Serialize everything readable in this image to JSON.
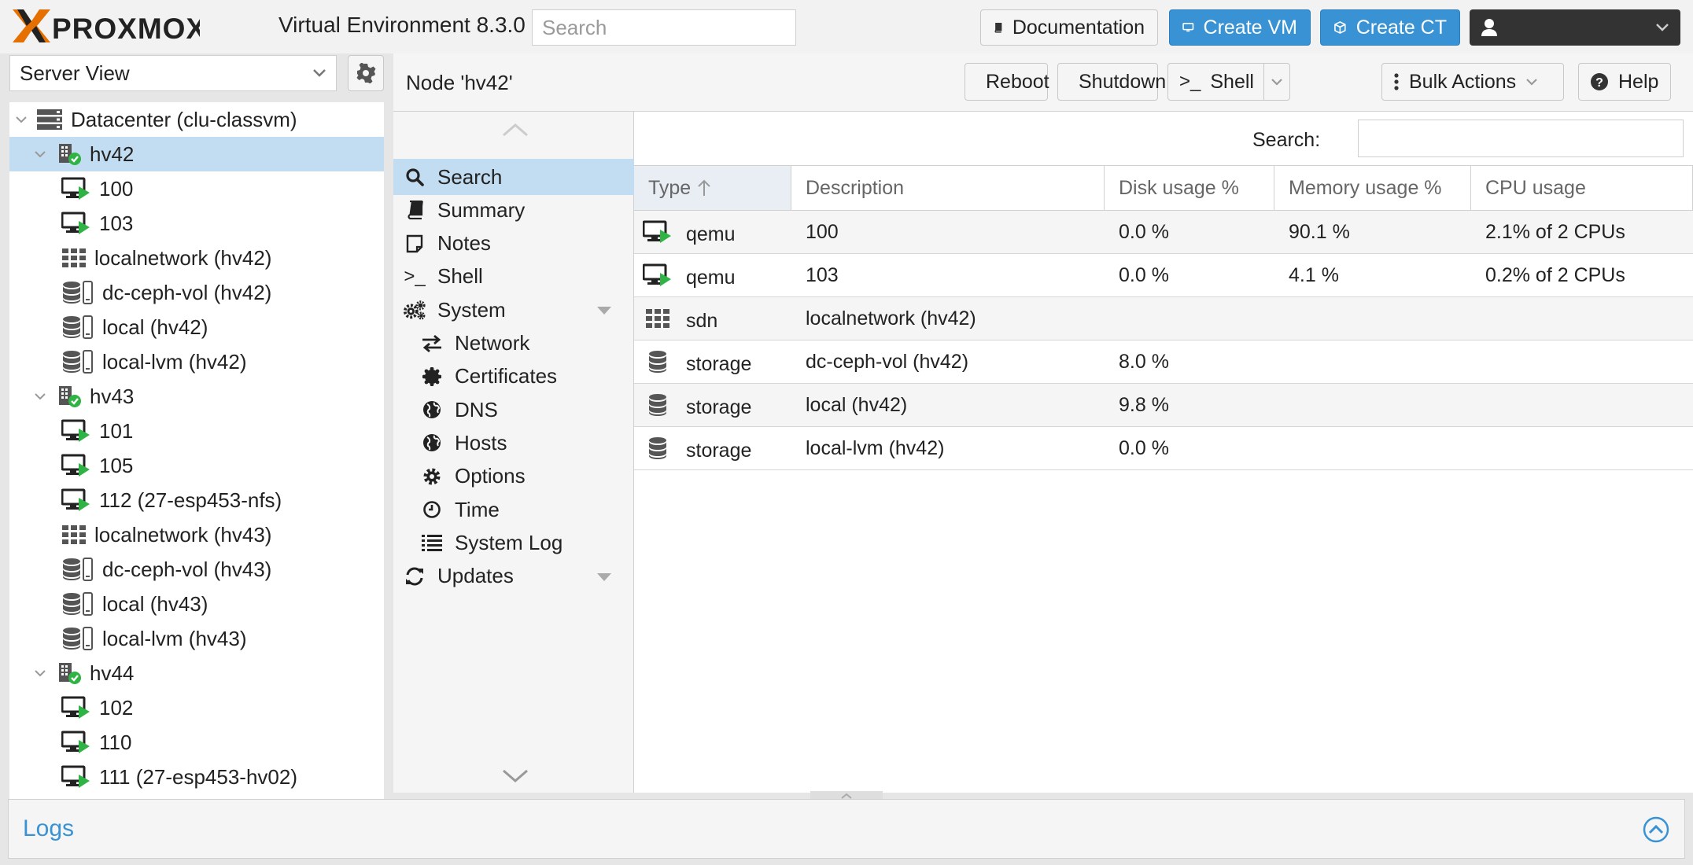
{
  "header": {
    "logo_text": "PROXMOX",
    "product": "Virtual Environment 8.3.0",
    "search_placeholder": "Search",
    "documentation": "Documentation",
    "create_vm": "Create VM",
    "create_ct": "Create CT"
  },
  "left": {
    "view": "Server View",
    "tree": [
      {
        "label": "Datacenter (clu-classvm)",
        "icon": "datacenter-icon",
        "level": 0,
        "expanded": true
      },
      {
        "label": "hv42",
        "icon": "node-online-icon",
        "level": 1,
        "expanded": true,
        "selected": true
      },
      {
        "label": "100",
        "icon": "vm-running-icon",
        "level": 2
      },
      {
        "label": "103",
        "icon": "vm-running-icon",
        "level": 2
      },
      {
        "label": "localnetwork (hv42)",
        "icon": "sdn-icon",
        "level": 2
      },
      {
        "label": "dc-ceph-vol (hv42)",
        "icon": "storage-icon",
        "level": 2
      },
      {
        "label": "local (hv42)",
        "icon": "storage-icon",
        "level": 2
      },
      {
        "label": "local-lvm (hv42)",
        "icon": "storage-icon",
        "level": 2
      },
      {
        "label": "hv43",
        "icon": "node-online-icon",
        "level": 1,
        "expanded": true
      },
      {
        "label": "101",
        "icon": "vm-running-icon",
        "level": 2
      },
      {
        "label": "105",
        "icon": "vm-running-icon",
        "level": 2
      },
      {
        "label": "112 (27-esp453-nfs)",
        "icon": "vm-running-icon",
        "level": 2
      },
      {
        "label": "localnetwork (hv43)",
        "icon": "sdn-icon",
        "level": 2
      },
      {
        "label": "dc-ceph-vol (hv43)",
        "icon": "storage-icon",
        "level": 2
      },
      {
        "label": "local (hv43)",
        "icon": "storage-icon",
        "level": 2
      },
      {
        "label": "local-lvm (hv43)",
        "icon": "storage-icon",
        "level": 2
      },
      {
        "label": "hv44",
        "icon": "node-online-icon",
        "level": 1,
        "expanded": true
      },
      {
        "label": "102",
        "icon": "vm-running-icon",
        "level": 2
      },
      {
        "label": "110",
        "icon": "vm-running-icon",
        "level": 2
      },
      {
        "label": "111 (27-esp453-hv02)",
        "icon": "vm-running-icon",
        "level": 2
      }
    ]
  },
  "main": {
    "title": "Node 'hv42'",
    "reboot": "Reboot",
    "shutdown": "Shutdown",
    "shell": "Shell",
    "bulk": "Bulk Actions",
    "help": "Help"
  },
  "nav": [
    {
      "label": "Search",
      "icon": "search-icon",
      "level": 0,
      "active": true
    },
    {
      "label": "Summary",
      "icon": "book-icon",
      "level": 0
    },
    {
      "label": "Notes",
      "icon": "notes-icon",
      "level": 0
    },
    {
      "label": "Shell",
      "icon": "terminal-icon",
      "level": 0
    },
    {
      "label": "System",
      "icon": "cogs-icon",
      "level": 0,
      "caret": true
    },
    {
      "label": "Network",
      "icon": "exchange-icon",
      "level": 1
    },
    {
      "label": "Certificates",
      "icon": "certificate-icon",
      "level": 1
    },
    {
      "label": "DNS",
      "icon": "globe-icon",
      "level": 1
    },
    {
      "label": "Hosts",
      "icon": "globe-icon",
      "level": 1
    },
    {
      "label": "Options",
      "icon": "gear-icon",
      "level": 1
    },
    {
      "label": "Time",
      "icon": "clock-icon",
      "level": 1
    },
    {
      "label": "System Log",
      "icon": "list-icon",
      "level": 1
    },
    {
      "label": "Updates",
      "icon": "refresh-icon",
      "level": 0,
      "caret": true
    }
  ],
  "content": {
    "search_label": "Search:",
    "columns": [
      "Type",
      "Description",
      "Disk usage %",
      "Memory usage %",
      "CPU usage"
    ],
    "rows": [
      {
        "icon": "vm-running-icon",
        "type": "qemu",
        "description": "100",
        "disk": "0.0 %",
        "memory": "90.1 %",
        "cpu": "2.1% of 2 CPUs"
      },
      {
        "icon": "vm-running-icon",
        "type": "qemu",
        "description": "103",
        "disk": "0.0 %",
        "memory": "4.1 %",
        "cpu": "0.2% of 2 CPUs"
      },
      {
        "icon": "sdn-icon",
        "type": "sdn",
        "description": "localnetwork (hv42)",
        "disk": "",
        "memory": "",
        "cpu": ""
      },
      {
        "icon": "storage-icon",
        "type": "storage",
        "description": "dc-ceph-vol (hv42)",
        "disk": "8.0 %",
        "memory": "",
        "cpu": ""
      },
      {
        "icon": "storage-icon",
        "type": "storage",
        "description": "local (hv42)",
        "disk": "9.8 %",
        "memory": "",
        "cpu": ""
      },
      {
        "icon": "storage-icon",
        "type": "storage",
        "description": "local-lvm (hv42)",
        "disk": "0.0 %",
        "memory": "",
        "cpu": ""
      }
    ]
  },
  "logs": {
    "title": "Logs"
  },
  "colors": {
    "accent": "#3892d4",
    "selected": "#c2ddf2",
    "running": "#2fb344",
    "orange": "#e57000"
  }
}
